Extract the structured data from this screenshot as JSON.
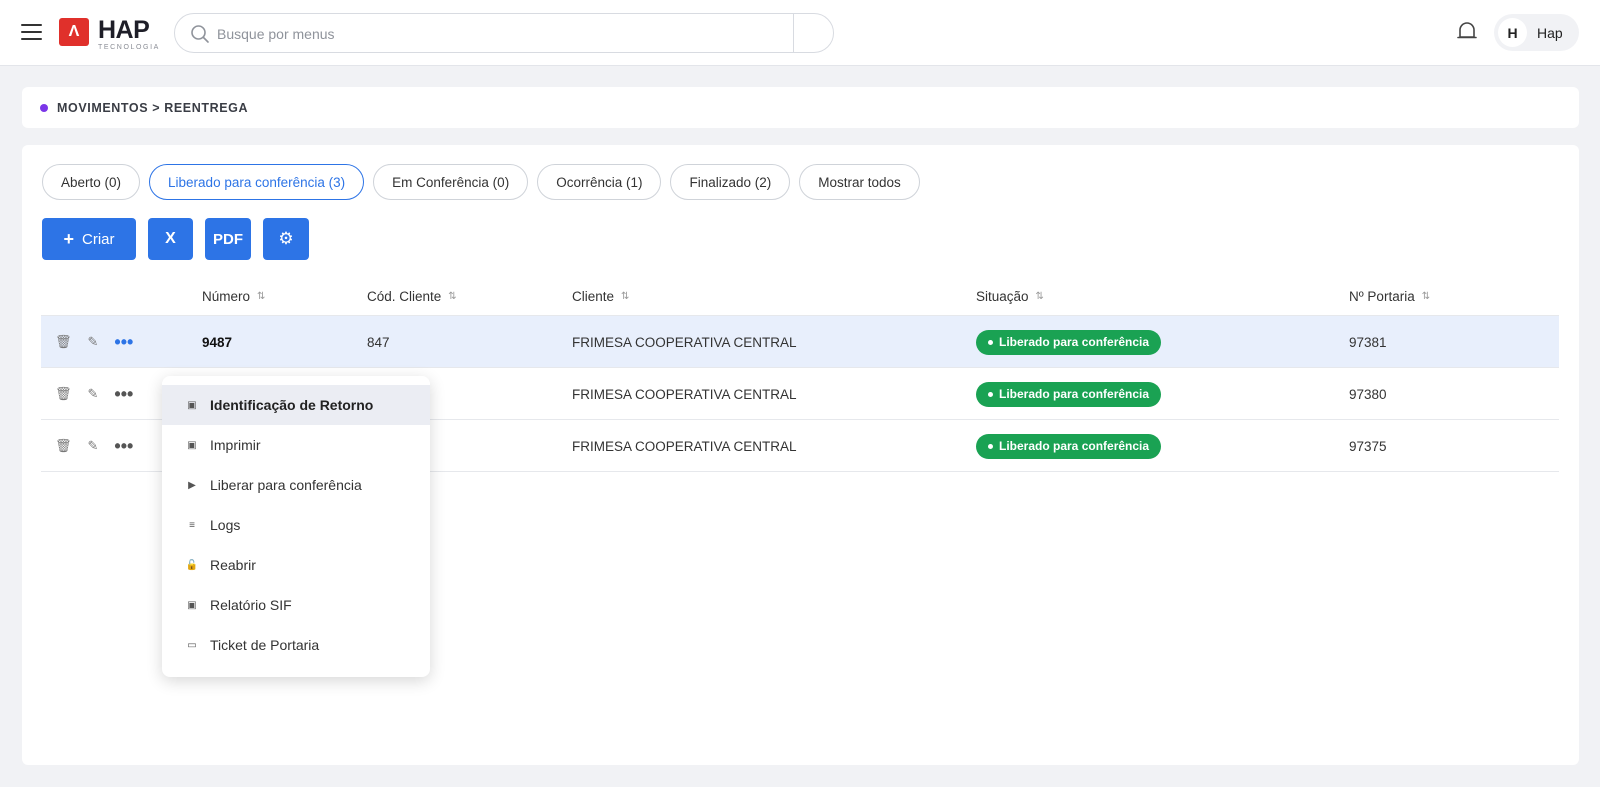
{
  "header": {
    "logo_mark": "Λ",
    "logo_name": "HAP",
    "logo_sub": "TECNOLOGIA",
    "search_placeholder": "Busque por menus",
    "user_initial": "H",
    "user_name": "Hap"
  },
  "breadcrumb": "MOVIMENTOS > REENTREGA",
  "tabs": [
    {
      "label": "Aberto (0)",
      "active": false
    },
    {
      "label": "Liberado para conferência (3)",
      "active": true
    },
    {
      "label": "Em Conferência (0)",
      "active": false
    },
    {
      "label": "Ocorrência (1)",
      "active": false
    },
    {
      "label": "Finalizado (2)",
      "active": false
    },
    {
      "label": "Mostrar todos",
      "active": false
    }
  ],
  "actions": {
    "create_label": "Criar",
    "create_icon": "+",
    "excel_label": "X",
    "pdf_label": "PDF",
    "settings_icon": "⚙"
  },
  "table": {
    "columns": [
      "Número",
      "Cód. Cliente",
      "Cliente",
      "Situação",
      "Nº Portaria"
    ],
    "sort_icon": "⇅",
    "rows": [
      {
        "numero": "9487",
        "cod_cliente": "847",
        "cliente": "FRIMESA COOPERATIVA CENTRAL",
        "situacao": "Liberado para conferência",
        "portaria": "97381"
      },
      {
        "numero": "",
        "cod_cliente": "",
        "cliente": "FRIMESA COOPERATIVA CENTRAL",
        "situacao": "Liberado para conferência",
        "portaria": "97380"
      },
      {
        "numero": "",
        "cod_cliente": "",
        "cliente": "FRIMESA COOPERATIVA CENTRAL",
        "situacao": "Liberado para conferência",
        "portaria": "97375"
      }
    ]
  },
  "colors": {
    "primary": "#2d74e6",
    "status_green": "#1aa253",
    "brand_red": "#e0302b",
    "breadcrumb_dot": "#7b36e8"
  },
  "dropdown": {
    "items": [
      {
        "label": "Identificação de Retorno",
        "icon": "▣"
      },
      {
        "label": "Imprimir",
        "icon": "▣"
      },
      {
        "label": "Liberar para conferência",
        "icon": "▶"
      },
      {
        "label": "Logs",
        "icon": "≡"
      },
      {
        "label": "Reabrir",
        "icon": "🔓"
      },
      {
        "label": "Relatório SIF",
        "icon": "▣"
      },
      {
        "label": "Ticket de Portaria",
        "icon": "▭"
      }
    ]
  }
}
